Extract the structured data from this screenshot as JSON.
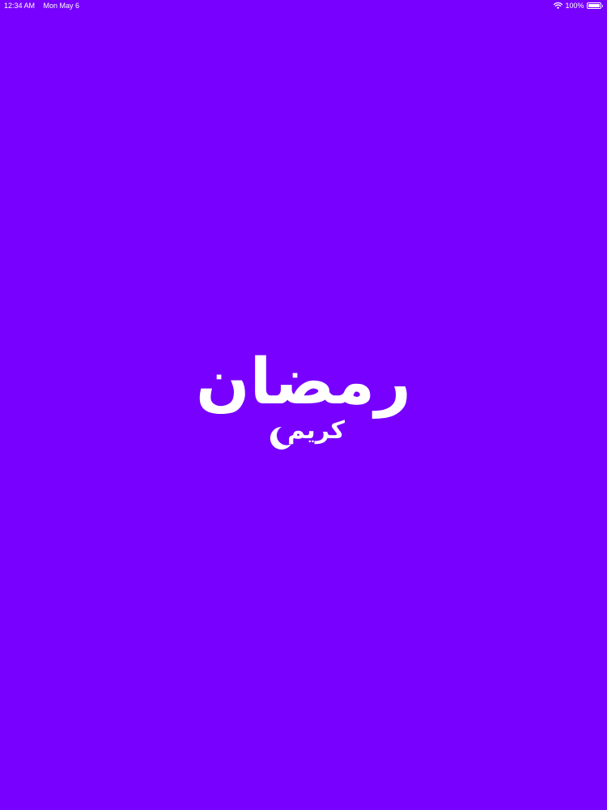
{
  "status_bar": {
    "time": "12:34 AM",
    "date": "Mon May 6",
    "battery_text": "100%",
    "battery_level": 1.0,
    "icons": [
      "wifi-icon",
      "battery-icon"
    ]
  },
  "splash": {
    "title": "رمضان",
    "subtitle": "كريم",
    "decoration_icon": "crescent-moon-icon"
  },
  "colors": {
    "background": "#7700ff",
    "foreground": "#ffffff"
  }
}
